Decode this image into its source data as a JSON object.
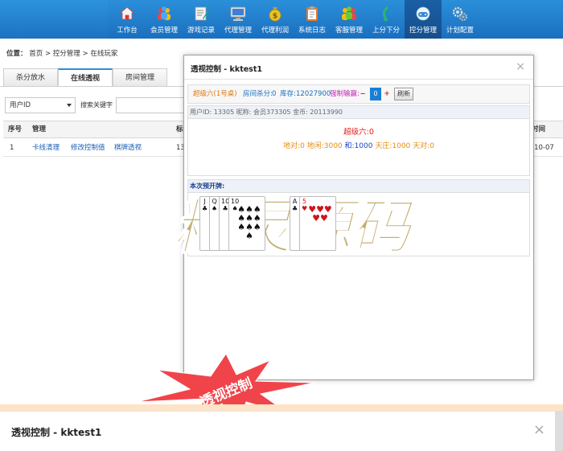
{
  "nav": {
    "items": [
      {
        "label": "工作台",
        "icon": "home-icon"
      },
      {
        "label": "会员管理",
        "icon": "members-icon"
      },
      {
        "label": "游戏记录",
        "icon": "game-record-icon"
      },
      {
        "label": "代理管理",
        "icon": "agent-monitor-icon"
      },
      {
        "label": "代理利润",
        "icon": "money-bag-icon"
      },
      {
        "label": "系统日志",
        "icon": "clipboard-icon"
      },
      {
        "label": "客服管理",
        "icon": "support-team-icon"
      },
      {
        "label": "上分下分",
        "icon": "transfer-icon"
      },
      {
        "label": "控分管理",
        "icon": "gamepad-icon"
      },
      {
        "label": "计划配置",
        "icon": "gears-icon"
      }
    ],
    "active_index": 8
  },
  "breadcrumb": {
    "prefix": "位置：",
    "items": [
      "首页",
      "控分管理",
      "在线玩家"
    ],
    "sep": ">"
  },
  "tabs": [
    "杀分放水",
    "在线透视",
    "房间管理"
  ],
  "active_tab": 1,
  "filter": {
    "select_value": "用户ID",
    "search_label": "搜索关键字"
  },
  "table": {
    "headers": [
      "序号",
      "管理",
      "标",
      "时间"
    ],
    "rows": [
      {
        "index": "1",
        "actions": [
          "卡线清理",
          "修改控制值",
          "棋牌透视"
        ],
        "col3": "13",
        "time": "-10-07"
      }
    ]
  },
  "modal": {
    "title": "透视控制 - kktest1",
    "close": "×",
    "room": "超级六(1号桌)",
    "room_score_label": "房间杀分:",
    "room_score_value": "0",
    "stock_label": "库存:",
    "stock_value": "12027900",
    "force_label": "强制输赢:",
    "minus": "−",
    "stepper_value": "0",
    "plus": "+",
    "refresh": "刷新",
    "user_info": "用户ID: 13305  昵称: 会员373305  金币: 20113990",
    "game_line": "超级六:0",
    "bets": [
      {
        "text": "地对:0",
        "hl": false
      },
      {
        "text": "地闲:3000",
        "hl": false
      },
      {
        "text": "和:1000",
        "hl": true
      },
      {
        "text": "天庄:1000",
        "hl": false
      },
      {
        "text": "天对:0",
        "hl": false
      }
    ],
    "cards_title": "本次预开牌:",
    "cards": [
      {
        "rank": "J",
        "suit": "♣",
        "color": "#111"
      },
      {
        "rank": "Q",
        "suit": "♠",
        "color": "#111"
      },
      {
        "rank": "10",
        "suit": "♣",
        "color": "#111"
      },
      {
        "rank": "10",
        "suit": "♠",
        "color": "#111"
      },
      {
        "rank": "A",
        "suit": "♣",
        "color": "#111"
      },
      {
        "rank": "5",
        "suit": "♥",
        "color": "#d0141c"
      }
    ]
  },
  "watermark": "精灵源码",
  "burst_label": "透视控制",
  "dialog2": {
    "title": "透视控制 - kktest1",
    "close": "×"
  },
  "colors": {
    "nav_bg": "#1a6fbf",
    "nav_active": "#164f8d",
    "accent_blue": "#1a7fd4",
    "red": "#e02020",
    "orange": "#e58d12",
    "watermark_fill": "#b9a25a",
    "burst_fill": "#f0444a"
  }
}
